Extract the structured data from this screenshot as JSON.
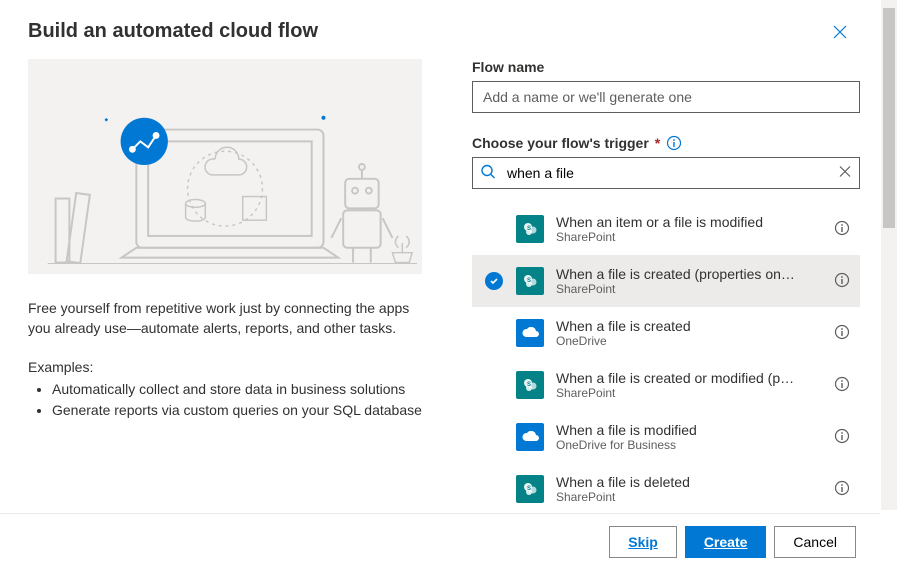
{
  "header": {
    "title": "Build an automated cloud flow"
  },
  "left": {
    "description": "Free yourself from repetitive work just by connecting the apps you already use—automate alerts, reports, and other tasks.",
    "examples_label": "Examples:",
    "examples": [
      "Automatically collect and store data in business solutions",
      "Generate reports via custom queries on your SQL database"
    ]
  },
  "form": {
    "flow_name_label": "Flow name",
    "flow_name_placeholder": "Add a name or we'll generate one",
    "flow_name_value": "",
    "trigger_label": "Choose your flow's trigger",
    "search_value": "when a file"
  },
  "triggers": [
    {
      "title": "When an item or a file is modified",
      "connector": "SharePoint",
      "icon": "sharepoint",
      "selected": false
    },
    {
      "title": "When a file is created (properties on…",
      "connector": "SharePoint",
      "icon": "sharepoint",
      "selected": true
    },
    {
      "title": "When a file is created",
      "connector": "OneDrive",
      "icon": "onedrive",
      "selected": false
    },
    {
      "title": "When a file is created or modified (p…",
      "connector": "SharePoint",
      "icon": "sharepoint",
      "selected": false
    },
    {
      "title": "When a file is modified",
      "connector": "OneDrive for Business",
      "icon": "onedrive",
      "selected": false
    },
    {
      "title": "When a file is deleted",
      "connector": "SharePoint",
      "icon": "sharepoint",
      "selected": false
    }
  ],
  "footer": {
    "skip": "Skip",
    "create": "Create",
    "cancel": "Cancel"
  },
  "icons": {
    "close": "close-icon",
    "info": "info-icon",
    "search": "search-icon",
    "clear": "clear-icon"
  }
}
